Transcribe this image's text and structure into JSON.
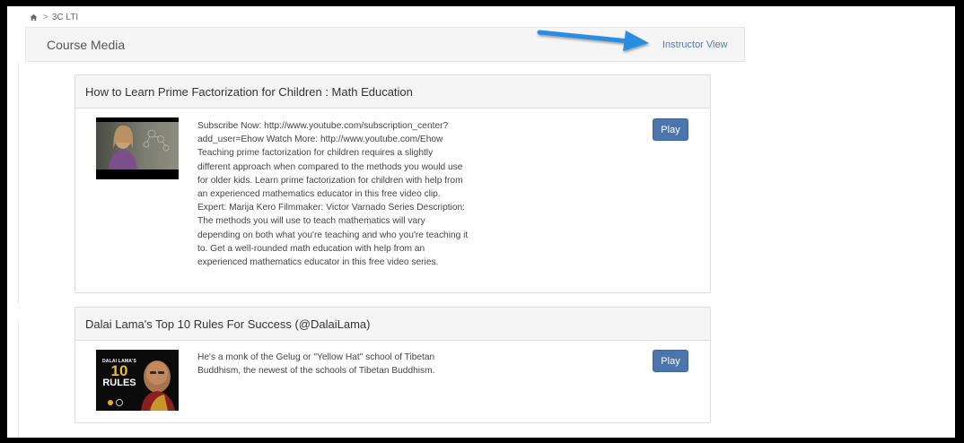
{
  "breadcrumb": {
    "home_icon": "home-icon",
    "separator": ">",
    "current": "3C LTI"
  },
  "header": {
    "title": "Course Media",
    "instructor_view": "Instructor View",
    "annotation_color": "#2a8ee0"
  },
  "media": [
    {
      "title": "How to Learn Prime Factorization for Children : Math Education",
      "description_lines": [
        "Subscribe Now: http://www.youtube.com/subscription_center?",
        "add_user=Ehow Watch More: http://www.youtube.com/Ehow",
        "Teaching prime factorization for children requires a slightly",
        "different approach when compared to the methods you would use",
        "for older kids. Learn prime factorization for children with help from",
        "an experienced mathematics educator in this free video clip.",
        "Expert: Marija Kero Filmmaker: Victor Varnado Series Description:",
        "The methods you will use to teach mathematics will vary",
        "depending on both what you're teaching and who you're teaching it",
        "to. Get a well-rounded math education with help from an",
        "experienced mathematics educator in this free video series."
      ],
      "play_label": "Play"
    },
    {
      "title": "Dalai Lama's Top 10 Rules For Success (@DalaiLama)",
      "description_lines": [
        "He's a monk of the Gelug or \"Yellow Hat\" school of Tibetan",
        "Buddhism, the newest of the schools of Tibetan Buddhism."
      ],
      "play_label": "Play",
      "thumb_text": {
        "line1": "DALAI LAMA'S",
        "line2": "10",
        "line3": "RULES"
      }
    }
  ],
  "colors": {
    "play_button": "#4d75ad",
    "link": "#4a7fb5",
    "header_bg": "#f5f5f5"
  }
}
